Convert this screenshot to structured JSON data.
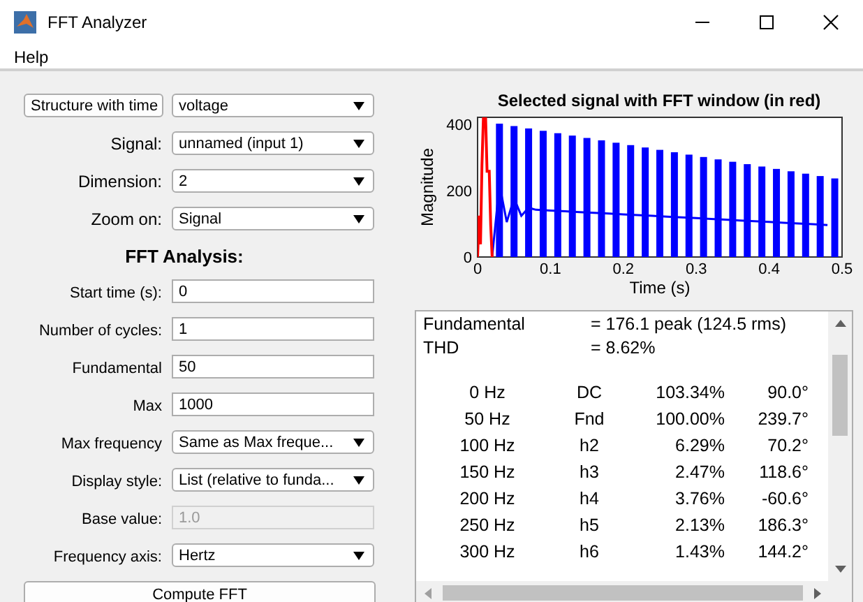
{
  "window": {
    "title": "FFT Analyzer"
  },
  "menu": [
    "Help"
  ],
  "source": {
    "button": "Structure with time",
    "value": "voltage"
  },
  "selectors": [
    {
      "label": "Signal:",
      "value": "unnamed (input 1)"
    },
    {
      "label": "Dimension:",
      "value": "2"
    },
    {
      "label": "Zoom on:",
      "value": "Signal"
    }
  ],
  "analysis_heading": "FFT Analysis:",
  "settings": [
    {
      "kind": "field",
      "label": "Start time (s):",
      "value": "0",
      "disabled": false
    },
    {
      "kind": "field",
      "label": "Number of cycles:",
      "value": "1",
      "disabled": false
    },
    {
      "kind": "field",
      "label": "Fundamental",
      "value": "50",
      "disabled": false
    },
    {
      "kind": "field",
      "label": "Max",
      "value": "1000",
      "disabled": false
    },
    {
      "kind": "dropdown",
      "label": "Max frequency",
      "value": "Same as Max freque..."
    },
    {
      "kind": "dropdown",
      "label": "Display style:",
      "value": "List (relative to funda..."
    },
    {
      "kind": "field",
      "label": "Base value:",
      "value": "1.0",
      "disabled": true
    },
    {
      "kind": "dropdown",
      "label": "Frequency axis:",
      "value": "Hertz"
    }
  ],
  "compute_button": "Compute FFT",
  "plot": {
    "title": "Selected signal with FFT window (in red)",
    "xlabel": "Time (s)",
    "ylabel": "Magnitude",
    "xticks": [
      "0",
      "0.1",
      "0.2",
      "0.3",
      "0.4",
      "0.5"
    ],
    "yticks": [
      "400",
      "200",
      "0"
    ]
  },
  "results": {
    "summary": [
      {
        "name": "Fundamental",
        "value": "=  176.1 peak (124.5 rms)"
      },
      {
        "name": "THD",
        "value": "=  8.62%"
      }
    ],
    "rows": [
      {
        "freq": "0 Hz",
        "order": "DC",
        "mag": "103.34%",
        "phase": "90.0°"
      },
      {
        "freq": "50 Hz",
        "order": "Fnd",
        "mag": "100.00%",
        "phase": "239.7°"
      },
      {
        "freq": "100 Hz",
        "order": "h2",
        "mag": "6.29%",
        "phase": "70.2°"
      },
      {
        "freq": "150 Hz",
        "order": "h3",
        "mag": "2.47%",
        "phase": "118.6°"
      },
      {
        "freq": "200 Hz",
        "order": "h4",
        "mag": "3.76%",
        "phase": "-60.6°"
      },
      {
        "freq": "250 Hz",
        "order": "h5",
        "mag": "2.13%",
        "phase": "186.3°"
      },
      {
        "freq": "300 Hz",
        "order": "h6",
        "mag": "1.43%",
        "phase": "144.2°"
      }
    ]
  }
}
